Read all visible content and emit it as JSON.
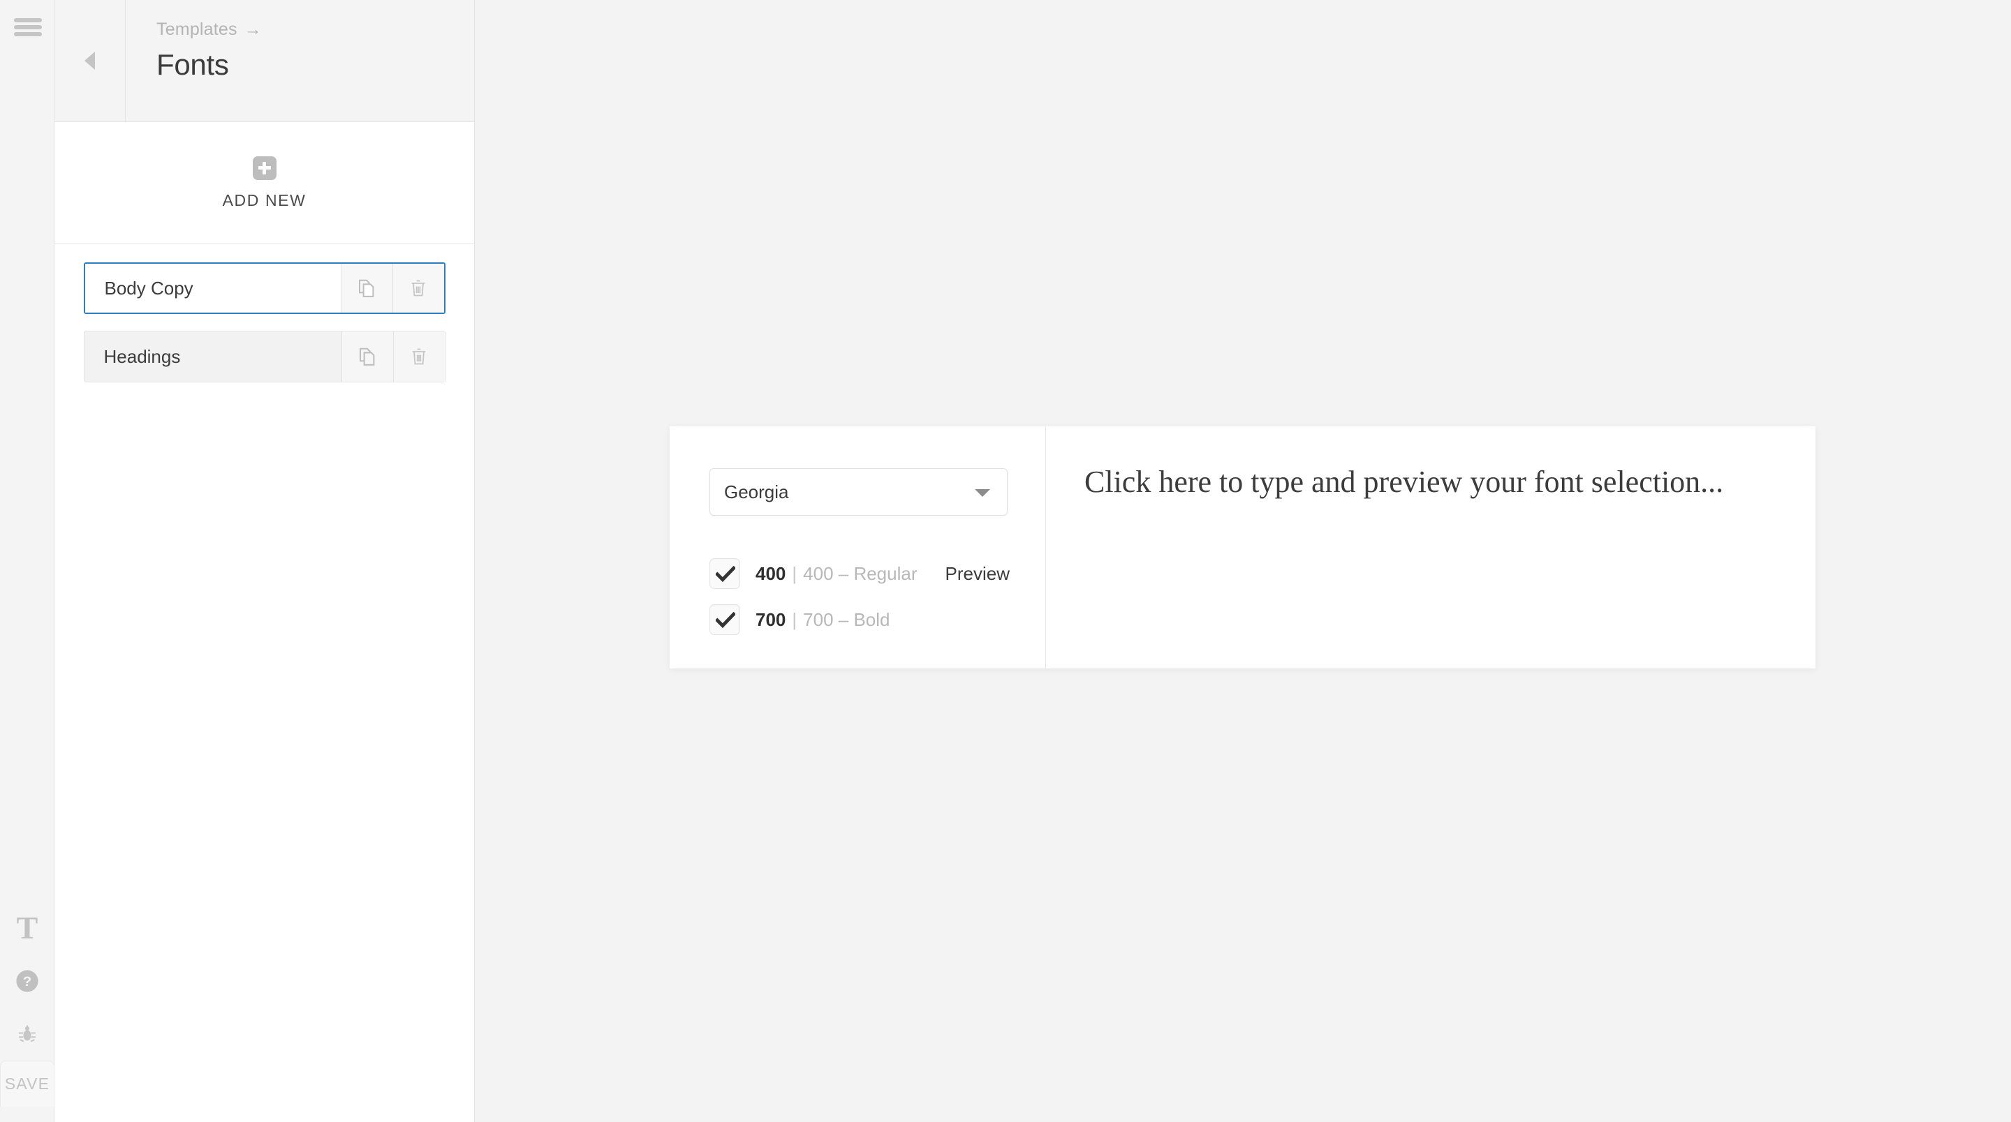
{
  "rail": {
    "hamburger": "menu-icon",
    "bottom_icons": [
      {
        "name": "typography-icon",
        "glyph": "T"
      },
      {
        "name": "help-icon",
        "glyph": "?"
      },
      {
        "name": "bug-icon",
        "glyph": "✱"
      }
    ],
    "save_label": "SAVE"
  },
  "sidebar": {
    "back_label": "◀",
    "breadcrumb": "Templates",
    "breadcrumb_arrow": "→",
    "title": "Fonts",
    "add_new_label": "ADD NEW",
    "items": [
      {
        "label": "Body Copy",
        "selected": true
      },
      {
        "label": "Headings",
        "selected": false
      }
    ],
    "row_actions": {
      "duplicate": "copy-icon",
      "delete": "trash-icon"
    }
  },
  "font_panel": {
    "family_selected": "Georgia",
    "weights": [
      {
        "num": "400",
        "sep": "|",
        "desc": "400 – Regular",
        "checked": true,
        "preview_label": "Preview"
      },
      {
        "num": "700",
        "sep": "|",
        "desc": "700 – Bold",
        "checked": true,
        "preview_label": ""
      }
    ],
    "preview_placeholder": "Click here to type and preview your font selection..."
  },
  "colors": {
    "accent": "#2b7fc0",
    "page_bg": "#f3f3f3",
    "panel_bg": "#ffffff",
    "muted_text": "#b8b8b8"
  }
}
